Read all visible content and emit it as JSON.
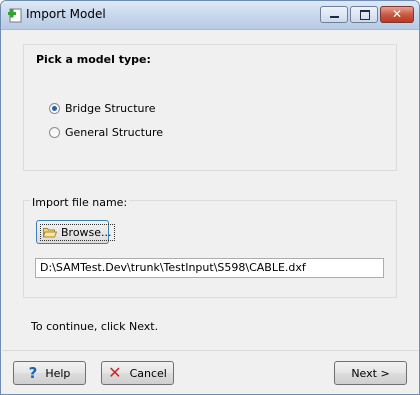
{
  "window": {
    "title": "Import Model"
  },
  "model_type": {
    "heading": "Pick a model type:",
    "options": [
      {
        "label": "Bridge Structure",
        "selected": true
      },
      {
        "label": "General Structure",
        "selected": false
      }
    ]
  },
  "import": {
    "label": "Import file name:",
    "browse_label": "Browse...",
    "file_path": "D:\\SAMTest.Dev\\trunk\\TestInput\\S598\\CABLE.dxf"
  },
  "hint": "To continue, click Next.",
  "footer": {
    "help_label": "Help",
    "cancel_label": "Cancel",
    "next_label": "Next >"
  },
  "icons": {
    "app": "import-model-icon",
    "browse": "folder-open-icon",
    "help": "question-mark-icon",
    "cancel": "red-x-icon"
  },
  "colors": {
    "accent": "#3c7fb1",
    "cancel_red": "#cc2a1e",
    "help_blue": "#1f63b8"
  }
}
